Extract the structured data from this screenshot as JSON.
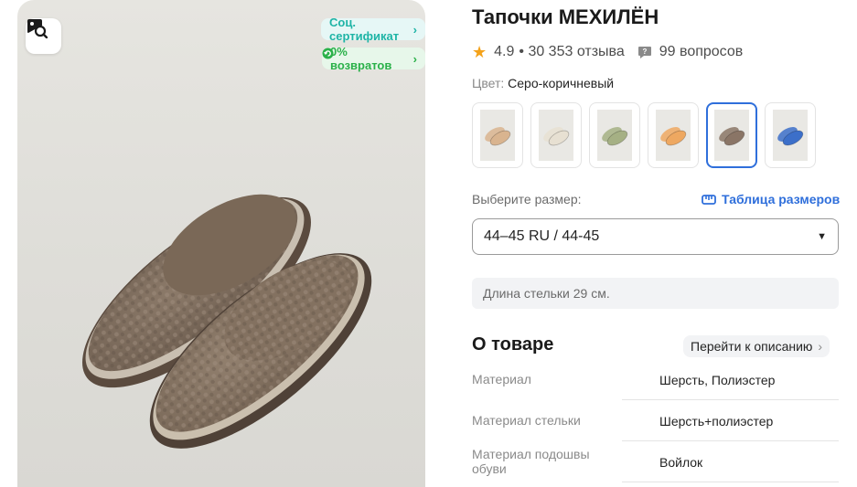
{
  "product": {
    "title": "Тапочки МЕХИЛЁН",
    "rating": "4.9",
    "reviews": "• 30 353 отзыва",
    "questions": "99 вопросов"
  },
  "badges": {
    "certificate": "Соц. сертификат",
    "returns": "0% возвратов"
  },
  "color": {
    "label": "Цвет:",
    "value": "Серо-коричневый",
    "swatches": [
      {
        "name": "beige",
        "hex": "#d9b48f"
      },
      {
        "name": "cream",
        "hex": "#e7e0d2"
      },
      {
        "name": "olive",
        "hex": "#a5b084"
      },
      {
        "name": "orange",
        "hex": "#eea861"
      },
      {
        "name": "grey-brown",
        "hex": "#8a7566",
        "selected": true
      },
      {
        "name": "blue",
        "hex": "#3c6fc9"
      }
    ]
  },
  "size": {
    "label": "Выберите размер:",
    "table_link": "Таблица размеров",
    "selected": "44–45 RU / 44-45",
    "insole": "Длина стельки 29 см."
  },
  "about": {
    "title": "О товаре",
    "goto": "Перейти к описанию",
    "properties": [
      {
        "key": "Материал",
        "value": "Шерсть, Полиэстер"
      },
      {
        "key": "Материал стельки",
        "value": "Шерсть+полиэстер"
      },
      {
        "key": "Материал подошвы обуви",
        "value": "Войлок"
      }
    ]
  },
  "icons": {
    "search_by_photo": "image-search-icon",
    "star": "star-icon",
    "questions": "chat-question-icon",
    "ruler": "ruler-icon"
  },
  "colors": {
    "accent_blue": "#2f6fdb",
    "teal": "#1eb4a6",
    "green": "#2bb14a",
    "star": "#f4a21a"
  }
}
